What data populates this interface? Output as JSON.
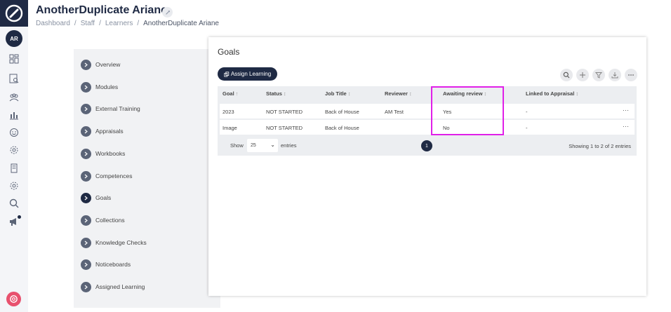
{
  "header": {
    "title": "AnotherDuplicate Ariane",
    "breadcrumb": [
      "Dashboard",
      "Staff",
      "Learners",
      "AnotherDuplicate Ariane"
    ]
  },
  "user": {
    "initials": "AR"
  },
  "rail_icons": [
    "dashboard-icon",
    "reports-icon",
    "users-icon",
    "analytics-icon",
    "smiley-icon",
    "settings-icon",
    "building-icon",
    "gear-icon",
    "search-icon",
    "megaphone-icon"
  ],
  "subnav": {
    "items": [
      {
        "label": "Overview"
      },
      {
        "label": "Modules"
      },
      {
        "label": "External Training"
      },
      {
        "label": "Appraisals"
      },
      {
        "label": "Workbooks"
      },
      {
        "label": "Competences"
      },
      {
        "label": "Goals"
      },
      {
        "label": "Collections"
      },
      {
        "label": "Knowledge Checks"
      },
      {
        "label": "Noticeboards"
      },
      {
        "label": "Assigned Learning"
      }
    ],
    "active": "Goals"
  },
  "panel": {
    "title": "Goals",
    "assign_label": "Assign Learning",
    "toolbar": [
      "search-icon",
      "plus-icon",
      "filter-icon",
      "download-icon",
      "more-icon"
    ]
  },
  "table": {
    "columns": [
      "Goal",
      "Status",
      "Job Title",
      "Reviewer",
      "Awaiting review",
      "Linked to Appraisal"
    ],
    "rows": [
      [
        "2023",
        "NOT STARTED",
        "Back of House",
        "AM Test",
        "Yes",
        "-"
      ],
      [
        "Image",
        "NOT STARTED",
        "Back of House",
        "",
        "No",
        "-"
      ]
    ],
    "row_menu": "···"
  },
  "footer": {
    "show_label": "Show",
    "page_size": "25",
    "entries_label": "entries",
    "current_page": "1",
    "showing_text": "Showing 1 to 2 of 2 entries"
  },
  "colors": {
    "brand_navy": "#1f2a44",
    "highlight": "#e020e8",
    "help": "#e8516e"
  }
}
